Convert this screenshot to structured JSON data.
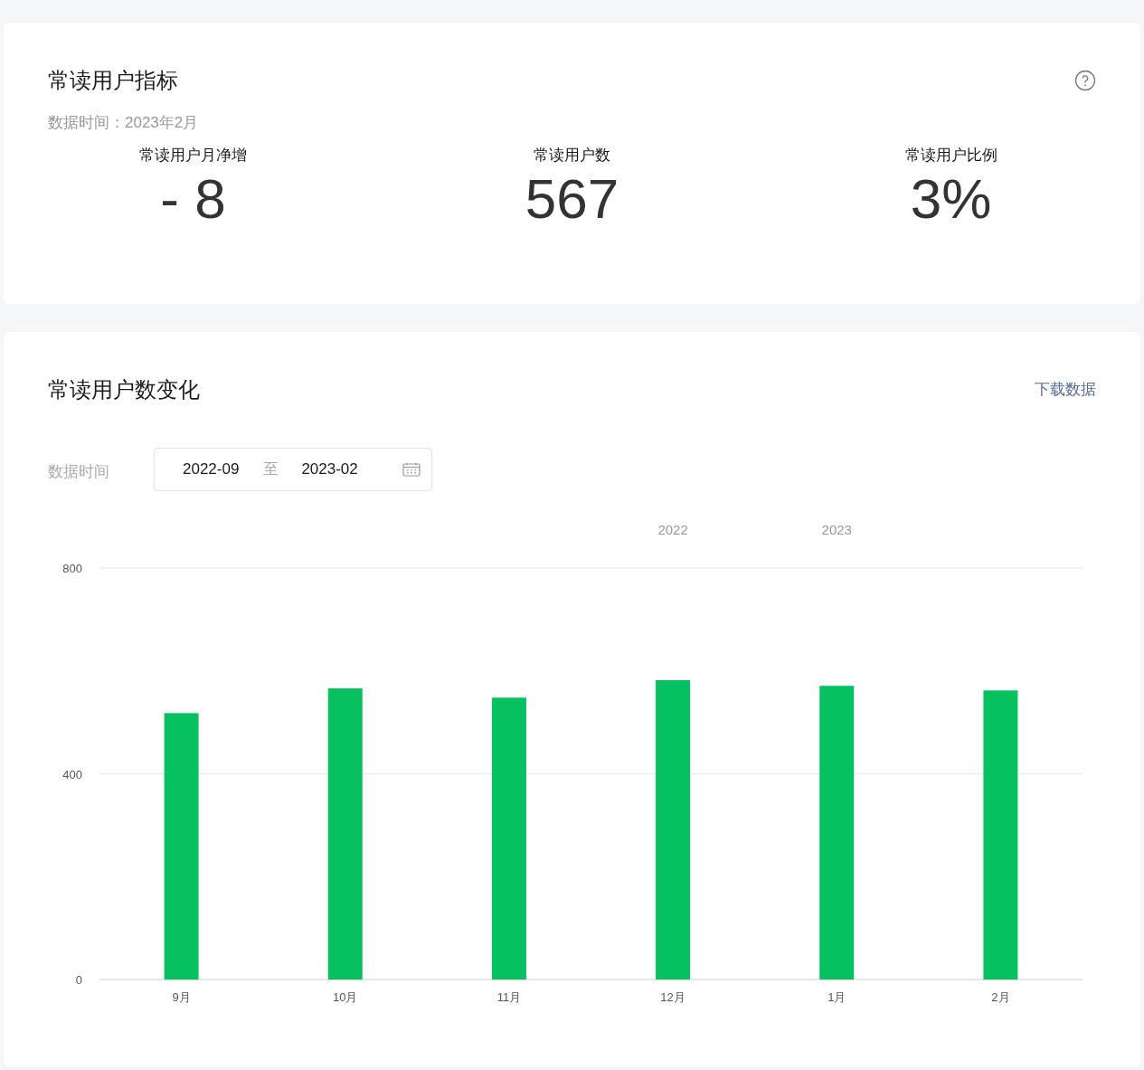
{
  "metrics_card": {
    "title": "常读用户指标",
    "data_time": "数据时间：2023年2月",
    "metrics": [
      {
        "label": "常读用户月净增",
        "value": "- 8"
      },
      {
        "label": "常读用户数",
        "value": "567"
      },
      {
        "label": "常读用户比例",
        "value": "3%"
      }
    ]
  },
  "trend_card": {
    "title": "常读用户数变化",
    "download_link": "下载数据",
    "filter_label": "数据时间",
    "date_range": {
      "start": "2022-09",
      "separator": "至",
      "end": "2023-02"
    },
    "chart_data": {
      "type": "bar",
      "categories": [
        "9月",
        "10月",
        "11月",
        "12月",
        "1月",
        "2月"
      ],
      "series": [
        {
          "color": "#07c160",
          "values": [
            518,
            566,
            548,
            582,
            571,
            562
          ]
        }
      ],
      "ylim": [
        0,
        800
      ],
      "yticks": [
        0,
        400,
        800
      ],
      "annotations": [
        "2022",
        "2023"
      ]
    }
  }
}
